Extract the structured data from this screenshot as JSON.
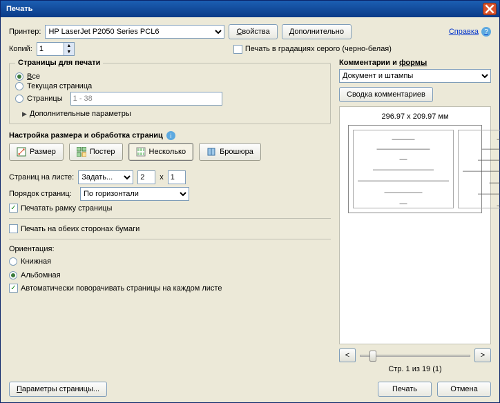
{
  "title": "Печать",
  "printer_label": "Принтер:",
  "printer_value": "HP LaserJet P2050 Series PCL6",
  "properties_btn": "Свойства",
  "advanced_btn": "Дополнительно",
  "help_link": "Справка",
  "copies_label": "Копий:",
  "copies_value": "1",
  "grayscale_label": "Печать в градациях серого (черно-белая)",
  "pages_legend": "Страницы для печати",
  "radio_all": "Все",
  "radio_current": "Текущая страница",
  "radio_pages": "Страницы",
  "pages_range": "1 - 38",
  "more_params": "Дополнительные параметры",
  "sizing_legend": "Настройка размера и обработка страниц",
  "tab_size": "Размер",
  "tab_poster": "Постер",
  "tab_multi": "Несколько",
  "tab_booklet": "Брошюра",
  "per_sheet_label": "Страниц на листе:",
  "per_sheet_value": "Задать...",
  "per_sheet_x": "2",
  "per_sheet_y": "1",
  "x_sep": "x",
  "order_label": "Порядок страниц:",
  "order_value": "По горизонтали",
  "print_border": "Печатать рамку страницы",
  "duplex": "Печать на обеих сторонах бумаги",
  "orientation_label": "Ориентация:",
  "orient_portrait": "Книжная",
  "orient_landscape": "Альбомная",
  "auto_rotate": "Автоматически поворачивать страницы на каждом листе",
  "comments_legend_a": "Комментарии и ",
  "comments_legend_b": "формы",
  "comments_value": "Документ и штампы",
  "comments_summary_btn": "Сводка комментариев",
  "paper_size": "296.97 x 209.97 мм",
  "page_status": "Стр. 1 из 19 (1)",
  "nav_prev": "<",
  "nav_next": ">",
  "page_setup_btn": "Параметры страницы...",
  "print_btn": "Печать",
  "cancel_btn": "Отмена",
  "underline": {
    "p": "П",
    "s": "С",
    "d": "Д",
    "v": "В"
  }
}
